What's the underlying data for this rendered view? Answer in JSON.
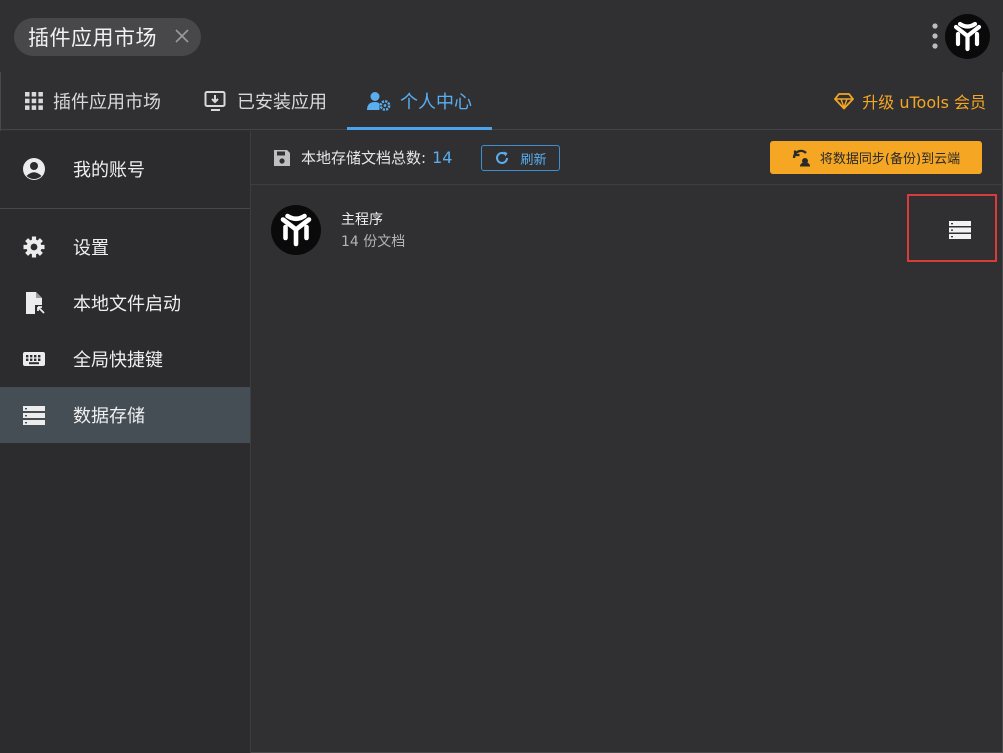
{
  "window": {
    "search_tag": "插件应用市场",
    "colors": {
      "bg": "#303033",
      "sidebar": "#2c2c2e",
      "accent": "#4ca5ec",
      "warning": "#f5a623",
      "highlight_border": "#d93a3a"
    }
  },
  "tabs": [
    {
      "label": "插件应用市场",
      "icon": "grid-icon",
      "active": false
    },
    {
      "label": "已安装应用",
      "icon": "monitor-download-icon",
      "active": false
    },
    {
      "label": "个人中心",
      "icon": "user-gear-icon",
      "active": true
    }
  ],
  "upgrade": {
    "label": "升级 uTools 会员",
    "icon": "diamond-icon"
  },
  "sidebar": {
    "items": [
      {
        "label": "我的账号",
        "icon": "account-circle-icon",
        "active": false
      },
      {
        "label": "设置",
        "icon": "gear-icon",
        "active": false
      },
      {
        "label": "本地文件启动",
        "icon": "file-launch-icon",
        "active": false
      },
      {
        "label": "全局快捷键",
        "icon": "keyboard-icon",
        "active": false
      },
      {
        "label": "数据存储",
        "icon": "storage-icon",
        "active": true
      }
    ]
  },
  "toolbar": {
    "stat_label": "本地存储文档总数:",
    "stat_count": "14",
    "refresh_label": "刷新",
    "sync_label": "将数据同步(备份)到云端"
  },
  "databases": [
    {
      "name": "主程序",
      "docs": "14 份文档",
      "icon": "utools-logo"
    }
  ]
}
